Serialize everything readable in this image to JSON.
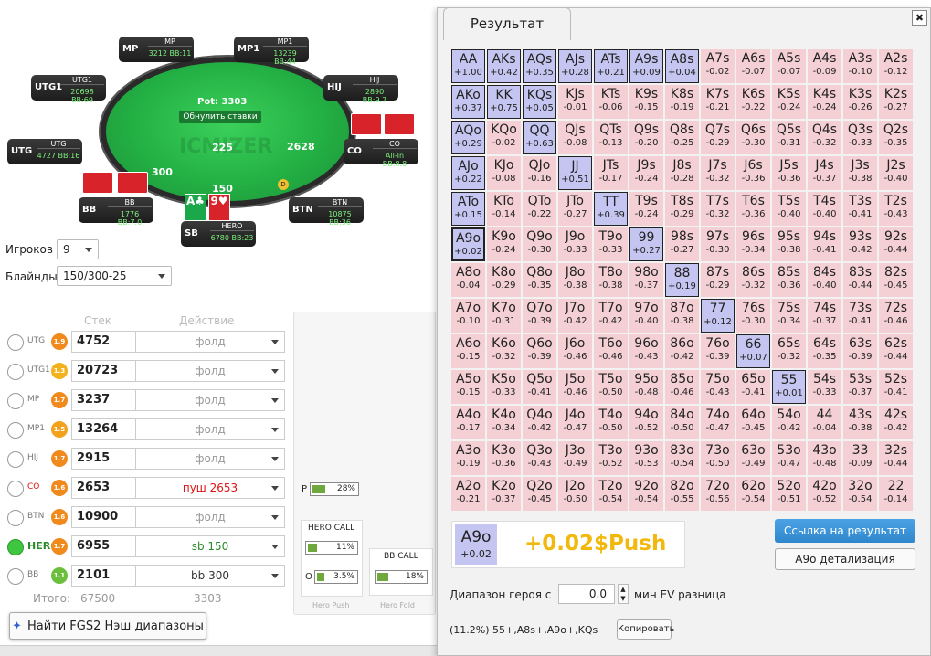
{
  "table": {
    "pot": "Pot: 3303",
    "reset": "Обнулить ставки",
    "watermark": "ICMIZER",
    "bets": {
      "mp": "225",
      "co": "2628",
      "utg": "300",
      "hero": "150"
    },
    "seats": [
      {
        "pos": "MP",
        "name": "MP",
        "stack": "3212 BB:11"
      },
      {
        "pos": "MP1",
        "name": "MP1",
        "stack": "13239 BB:44"
      },
      {
        "pos": "UTG1",
        "name": "UTG1",
        "stack": "20698 BB:69"
      },
      {
        "pos": "HIJ",
        "name": "HIJ",
        "stack": "2890 BB:9.7"
      },
      {
        "pos": "UTG",
        "name": "UTG",
        "stack": "4727 BB:16"
      },
      {
        "pos": "CO",
        "name": "CO",
        "stack": "All-In BB:8.8"
      },
      {
        "pos": "BB",
        "name": "BB",
        "stack": "1776 BB:7.0"
      },
      {
        "pos": "BTN",
        "name": "BTN",
        "stack": "10875 BB:36"
      },
      {
        "pos": "SB",
        "name": "HERO",
        "stack": "6780 BB:23"
      }
    ],
    "hero_cards": [
      "A♣",
      "9♥"
    ]
  },
  "controls": {
    "players_label": "Игроков",
    "players_value": "9",
    "blinds_label": "Блайнды",
    "blinds_value": "150/300-25",
    "stack_header": "Стек",
    "action_header": "Действие",
    "rows": [
      {
        "pos": "UTG",
        "badge": "1.9",
        "color": "#f08a1c",
        "stack": "4752",
        "action": "фолд",
        "act_color": "#999"
      },
      {
        "pos": "UTG1",
        "badge": "1.3",
        "color": "#f2b21c",
        "stack": "20723",
        "action": "фолд",
        "act_color": "#999"
      },
      {
        "pos": "MP",
        "badge": "1.7",
        "color": "#f08a1c",
        "stack": "3237",
        "action": "фолд",
        "act_color": "#999"
      },
      {
        "pos": "MP1",
        "badge": "1.5",
        "color": "#f2a21c",
        "stack": "13264",
        "action": "фолд",
        "act_color": "#999"
      },
      {
        "pos": "HIJ",
        "badge": "1.7",
        "color": "#f08a1c",
        "stack": "2915",
        "action": "фолд",
        "act_color": "#999"
      },
      {
        "pos": "CO",
        "badge": "1.6",
        "color": "#f08a1c",
        "stack": "2653",
        "action": "пуш 2653",
        "act_color": "#d11"
      },
      {
        "pos": "BTN",
        "badge": "1.6",
        "color": "#f08a1c",
        "stack": "10900",
        "action": "фолд",
        "act_color": "#999"
      },
      {
        "pos": "HERO",
        "badge": "1.7",
        "color": "#f08a1c",
        "stack": "6955",
        "action": "sb 150",
        "act_color": "#2a8a2a"
      },
      {
        "pos": "BB",
        "badge": "1.1",
        "color": "#6cbf3c",
        "stack": "2101",
        "action": "bb 300",
        "act_color": "#333"
      }
    ],
    "total_label": "Итого:",
    "total_stack": "67500",
    "total_action": "3303",
    "find_button": "Найти FGS2 Нэш диапазоны"
  },
  "tree": {
    "p_label": "P",
    "p_pct": "28%",
    "hero_call": "HERO CALL",
    "hero_call_pct": "11%",
    "o_label": "O",
    "o_pct": "3.5%",
    "bb_call": "BB CALL",
    "bb_call_pct": "18%",
    "hero_push": "Hero Push",
    "hero_fold": "Hero Fold"
  },
  "result": {
    "title": "Результат",
    "close": "✖",
    "selected_hand": "A9o",
    "selected_ev": "+0.02",
    "verdict": "+0.02$Push",
    "link_button": "Ссылка на результат",
    "detail_button": "A9o детализация",
    "range_label": "Диапазон героя с",
    "range_value": "0.0",
    "min_ev_label": "мин EV разница",
    "range_text": "(11.2%) 55+,A8s+,A9o+,KQs",
    "copy_button": "Копировать"
  },
  "grid": [
    [
      [
        "AA",
        "+1.00",
        1
      ],
      [
        "AKs",
        "+0.42",
        1
      ],
      [
        "AQs",
        "+0.35",
        1
      ],
      [
        "AJs",
        "+0.28",
        1
      ],
      [
        "ATs",
        "+0.21",
        1
      ],
      [
        "A9s",
        "+0.09",
        1
      ],
      [
        "A8s",
        "+0.04",
        1
      ],
      [
        "A7s",
        "-0.02",
        0
      ],
      [
        "A6s",
        "-0.07",
        0
      ],
      [
        "A5s",
        "-0.07",
        0
      ],
      [
        "A4s",
        "-0.09",
        0
      ],
      [
        "A3s",
        "-0.10",
        0
      ],
      [
        "A2s",
        "-0.12",
        0
      ]
    ],
    [
      [
        "AKo",
        "+0.37",
        1
      ],
      [
        "KK",
        "+0.75",
        1
      ],
      [
        "KQs",
        "+0.05",
        1
      ],
      [
        "KJs",
        "-0.01",
        0
      ],
      [
        "KTs",
        "-0.06",
        0
      ],
      [
        "K9s",
        "-0.15",
        0
      ],
      [
        "K8s",
        "-0.19",
        0
      ],
      [
        "K7s",
        "-0.21",
        0
      ],
      [
        "K6s",
        "-0.22",
        0
      ],
      [
        "K5s",
        "-0.24",
        0
      ],
      [
        "K4s",
        "-0.24",
        0
      ],
      [
        "K3s",
        "-0.26",
        0
      ],
      [
        "K2s",
        "-0.27",
        0
      ]
    ],
    [
      [
        "AQo",
        "+0.29",
        1
      ],
      [
        "KQo",
        "-0.02",
        0
      ],
      [
        "QQ",
        "+0.63",
        1
      ],
      [
        "QJs",
        "-0.08",
        0
      ],
      [
        "QTs",
        "-0.13",
        0
      ],
      [
        "Q9s",
        "-0.20",
        0
      ],
      [
        "Q8s",
        "-0.25",
        0
      ],
      [
        "Q7s",
        "-0.29",
        0
      ],
      [
        "Q6s",
        "-0.30",
        0
      ],
      [
        "Q5s",
        "-0.31",
        0
      ],
      [
        "Q4s",
        "-0.32",
        0
      ],
      [
        "Q3s",
        "-0.33",
        0
      ],
      [
        "Q2s",
        "-0.35",
        0
      ]
    ],
    [
      [
        "AJo",
        "+0.22",
        1
      ],
      [
        "KJo",
        "-0.08",
        0
      ],
      [
        "QJo",
        "-0.16",
        0
      ],
      [
        "JJ",
        "+0.51",
        1
      ],
      [
        "JTs",
        "-0.17",
        0
      ],
      [
        "J9s",
        "-0.24",
        0
      ],
      [
        "J8s",
        "-0.28",
        0
      ],
      [
        "J7s",
        "-0.32",
        0
      ],
      [
        "J6s",
        "-0.36",
        0
      ],
      [
        "J5s",
        "-0.36",
        0
      ],
      [
        "J4s",
        "-0.37",
        0
      ],
      [
        "J3s",
        "-0.38",
        0
      ],
      [
        "J2s",
        "-0.40",
        0
      ]
    ],
    [
      [
        "ATo",
        "+0.15",
        1
      ],
      [
        "KTo",
        "-0.14",
        0
      ],
      [
        "QTo",
        "-0.22",
        0
      ],
      [
        "JTo",
        "-0.27",
        0
      ],
      [
        "TT",
        "+0.39",
        1
      ],
      [
        "T9s",
        "-0.24",
        0
      ],
      [
        "T8s",
        "-0.29",
        0
      ],
      [
        "T7s",
        "-0.32",
        0
      ],
      [
        "T6s",
        "-0.36",
        0
      ],
      [
        "T5s",
        "-0.40",
        0
      ],
      [
        "T4s",
        "-0.40",
        0
      ],
      [
        "T3s",
        "-0.41",
        0
      ],
      [
        "T2s",
        "-0.43",
        0
      ]
    ],
    [
      [
        "A9o",
        "+0.02",
        2
      ],
      [
        "K9o",
        "-0.24",
        0
      ],
      [
        "Q9o",
        "-0.30",
        0
      ],
      [
        "J9o",
        "-0.33",
        0
      ],
      [
        "T9o",
        "-0.33",
        0
      ],
      [
        "99",
        "+0.27",
        1
      ],
      [
        "98s",
        "-0.27",
        0
      ],
      [
        "97s",
        "-0.30",
        0
      ],
      [
        "96s",
        "-0.34",
        0
      ],
      [
        "95s",
        "-0.38",
        0
      ],
      [
        "94s",
        "-0.41",
        0
      ],
      [
        "93s",
        "-0.42",
        0
      ],
      [
        "92s",
        "-0.44",
        0
      ]
    ],
    [
      [
        "A8o",
        "-0.04",
        0
      ],
      [
        "K8o",
        "-0.29",
        0
      ],
      [
        "Q8o",
        "-0.35",
        0
      ],
      [
        "J8o",
        "-0.38",
        0
      ],
      [
        "T8o",
        "-0.38",
        0
      ],
      [
        "98o",
        "-0.37",
        0
      ],
      [
        "88",
        "+0.19",
        1
      ],
      [
        "87s",
        "-0.29",
        0
      ],
      [
        "86s",
        "-0.32",
        0
      ],
      [
        "85s",
        "-0.36",
        0
      ],
      [
        "84s",
        "-0.40",
        0
      ],
      [
        "83s",
        "-0.44",
        0
      ],
      [
        "82s",
        "-0.45",
        0
      ]
    ],
    [
      [
        "A7o",
        "-0.10",
        0
      ],
      [
        "K7o",
        "-0.31",
        0
      ],
      [
        "Q7o",
        "-0.39",
        0
      ],
      [
        "J7o",
        "-0.42",
        0
      ],
      [
        "T7o",
        "-0.42",
        0
      ],
      [
        "97o",
        "-0.40",
        0
      ],
      [
        "87o",
        "-0.38",
        0
      ],
      [
        "77",
        "+0.12",
        1
      ],
      [
        "76s",
        "-0.30",
        0
      ],
      [
        "75s",
        "-0.34",
        0
      ],
      [
        "74s",
        "-0.37",
        0
      ],
      [
        "73s",
        "-0.41",
        0
      ],
      [
        "72s",
        "-0.46",
        0
      ]
    ],
    [
      [
        "A6o",
        "-0.15",
        0
      ],
      [
        "K6o",
        "-0.32",
        0
      ],
      [
        "Q6o",
        "-0.39",
        0
      ],
      [
        "J6o",
        "-0.46",
        0
      ],
      [
        "T6o",
        "-0.46",
        0
      ],
      [
        "96o",
        "-0.43",
        0
      ],
      [
        "86o",
        "-0.42",
        0
      ],
      [
        "76o",
        "-0.39",
        0
      ],
      [
        "66",
        "+0.07",
        1
      ],
      [
        "65s",
        "-0.32",
        0
      ],
      [
        "64s",
        "-0.35",
        0
      ],
      [
        "63s",
        "-0.39",
        0
      ],
      [
        "62s",
        "-0.44",
        0
      ]
    ],
    [
      [
        "A5o",
        "-0.15",
        0
      ],
      [
        "K5o",
        "-0.33",
        0
      ],
      [
        "Q5o",
        "-0.41",
        0
      ],
      [
        "J5o",
        "-0.46",
        0
      ],
      [
        "T5o",
        "-0.50",
        0
      ],
      [
        "95o",
        "-0.48",
        0
      ],
      [
        "85o",
        "-0.46",
        0
      ],
      [
        "75o",
        "-0.43",
        0
      ],
      [
        "65o",
        "-0.41",
        0
      ],
      [
        "55",
        "+0.01",
        1
      ],
      [
        "54s",
        "-0.33",
        0
      ],
      [
        "53s",
        "-0.37",
        0
      ],
      [
        "52s",
        "-0.41",
        0
      ]
    ],
    [
      [
        "A4o",
        "-0.17",
        0
      ],
      [
        "K4o",
        "-0.34",
        0
      ],
      [
        "Q4o",
        "-0.42",
        0
      ],
      [
        "J4o",
        "-0.47",
        0
      ],
      [
        "T4o",
        "-0.50",
        0
      ],
      [
        "94o",
        "-0.52",
        0
      ],
      [
        "84o",
        "-0.50",
        0
      ],
      [
        "74o",
        "-0.47",
        0
      ],
      [
        "64o",
        "-0.45",
        0
      ],
      [
        "54o",
        "-0.42",
        0
      ],
      [
        "44",
        "-0.04",
        0
      ],
      [
        "43s",
        "-0.38",
        0
      ],
      [
        "42s",
        "-0.42",
        0
      ]
    ],
    [
      [
        "A3o",
        "-0.19",
        0
      ],
      [
        "K3o",
        "-0.36",
        0
      ],
      [
        "Q3o",
        "-0.43",
        0
      ],
      [
        "J3o",
        "-0.49",
        0
      ],
      [
        "T3o",
        "-0.52",
        0
      ],
      [
        "93o",
        "-0.53",
        0
      ],
      [
        "83o",
        "-0.54",
        0
      ],
      [
        "73o",
        "-0.50",
        0
      ],
      [
        "63o",
        "-0.49",
        0
      ],
      [
        "53o",
        "-0.47",
        0
      ],
      [
        "43o",
        "-0.48",
        0
      ],
      [
        "33",
        "-0.09",
        0
      ],
      [
        "32s",
        "-0.44",
        0
      ]
    ],
    [
      [
        "A2o",
        "-0.21",
        0
      ],
      [
        "K2o",
        "-0.37",
        0
      ],
      [
        "Q2o",
        "-0.45",
        0
      ],
      [
        "J2o",
        "-0.50",
        0
      ],
      [
        "T2o",
        "-0.54",
        0
      ],
      [
        "92o",
        "-0.54",
        0
      ],
      [
        "82o",
        "-0.55",
        0
      ],
      [
        "72o",
        "-0.56",
        0
      ],
      [
        "62o",
        "-0.54",
        0
      ],
      [
        "52o",
        "-0.51",
        0
      ],
      [
        "42o",
        "-0.52",
        0
      ],
      [
        "32o",
        "-0.54",
        0
      ],
      [
        "22",
        "-0.14",
        0
      ]
    ]
  ]
}
